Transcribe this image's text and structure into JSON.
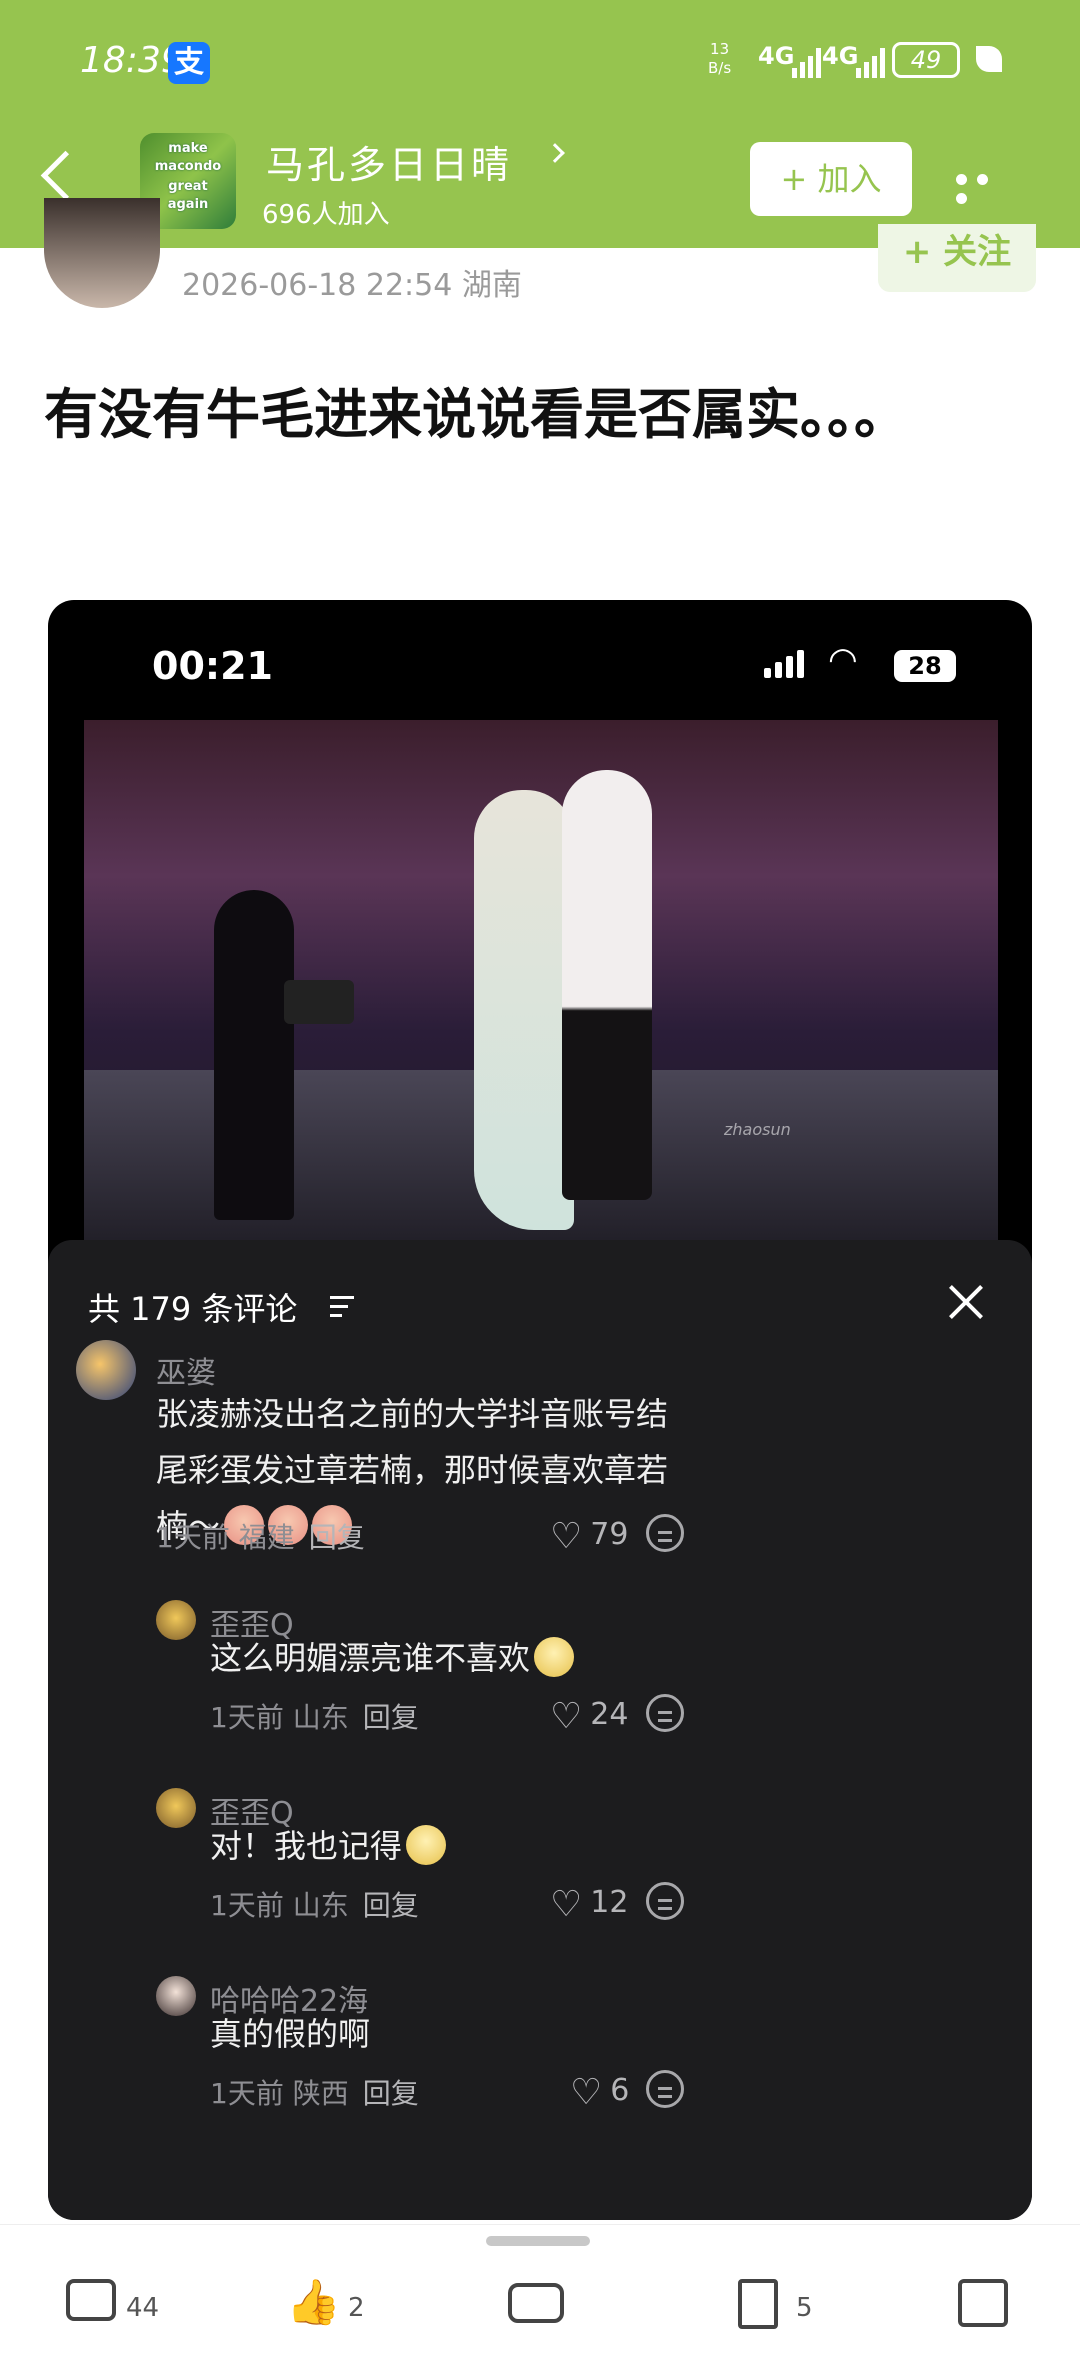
{
  "status_bar": {
    "time": "18:39",
    "alipay_glyph": "支",
    "net_speed_value": "13",
    "net_speed_unit": "B/s",
    "signal1": "4G",
    "signal2": "4G",
    "battery": "49"
  },
  "header": {
    "group_logo_lines": [
      "make",
      "macondo",
      "great",
      "again"
    ],
    "group_name": "马孔多日日晴",
    "member_count": "696人加入",
    "join_label": "+ 加入"
  },
  "post": {
    "date_location": "2026-06-18 22:54  湖南",
    "follow_label": "+ 关注",
    "title": "有没有牛毛进来说说看是否属实。。。"
  },
  "screenshot": {
    "time": "00:21",
    "battery": "28",
    "watermark": "zhaosun",
    "comments_header": "共 179 条评论",
    "comments": [
      {
        "user": "巫婆",
        "text": "张凌赫没出名之前的大学抖音账号结尾彩蛋发过章若楠，那时候喜欢章若楠～",
        "meta": "1天前 福建",
        "reply": "回复",
        "likes": "79"
      },
      {
        "user": "歪歪Q",
        "text": "这么明媚漂亮谁不喜欢",
        "meta": "1天前 山东",
        "reply": "回复",
        "likes": "24"
      },
      {
        "user": "歪歪Q",
        "text": "对！我也记得",
        "meta": "1天前 山东",
        "reply": "回复",
        "likes": "12"
      },
      {
        "user": "哈哈哈22海",
        "text": "真的假的啊",
        "meta": "1天前 陕西",
        "reply": "回复",
        "likes": "6"
      }
    ]
  },
  "bottom_bar": {
    "comment_count": "44",
    "like_count": "2",
    "bookmark_count": "5"
  },
  "icons": {
    "back": "chevron-left-icon",
    "more": "more-dots-icon",
    "like": "heart-icon",
    "emoji": "emoji-reaction-icon",
    "close": "close-icon",
    "comment": "comment-icon",
    "thumb": "thumbs-up-icon",
    "repost": "repost-icon",
    "bookmark": "bookmark-icon",
    "gift": "gift-icon"
  },
  "colors": {
    "brand_green": "#96c44f",
    "sheet_bg": "#1c1c1e"
  }
}
